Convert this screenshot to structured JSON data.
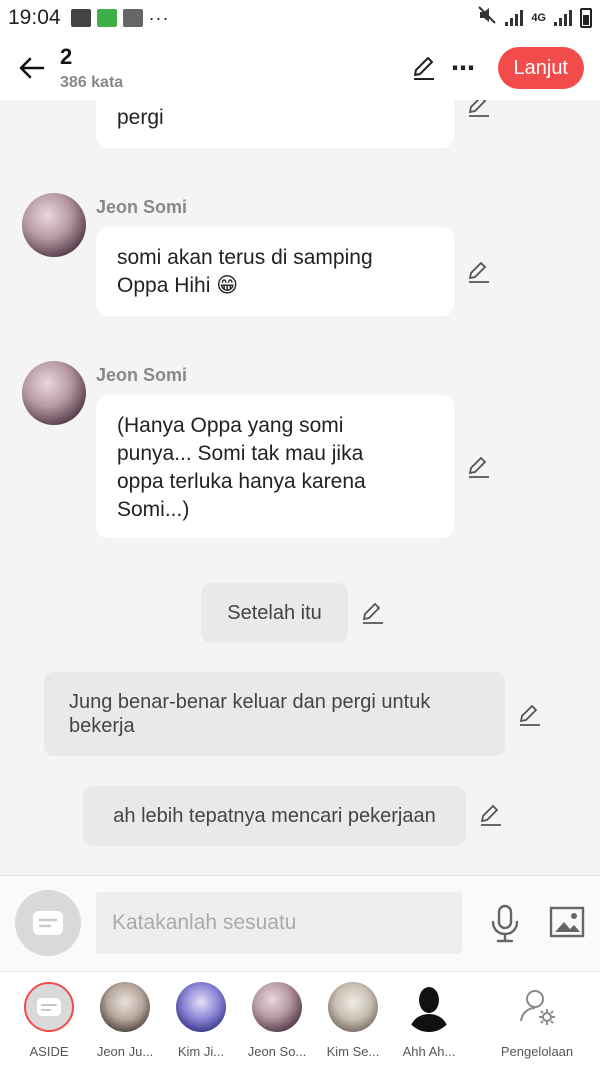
{
  "status_bar": {
    "time": "19:04",
    "network": "4G"
  },
  "header": {
    "title": "2",
    "word_count": "386 kata",
    "continue_label": "Lanjut"
  },
  "messages": [
    {
      "type": "dialog",
      "text": "pergi"
    },
    {
      "type": "dialog",
      "speaker": "Jeon Somi",
      "text_line1": "somi akan terus di samping",
      "text_line2": "Oppa Hihi 😁"
    },
    {
      "type": "dialog",
      "speaker": "Jeon Somi",
      "text_line1": "(Hanya Oppa yang somi",
      "text_line2": "punya... Somi tak mau jika",
      "text_line3": "oppa terluka hanya karena",
      "text_line4": "Somi...)"
    },
    {
      "type": "narration",
      "text": "Setelah itu"
    },
    {
      "type": "narration",
      "text_line1": "Jung benar-benar keluar dan pergi untuk",
      "text_line2": "bekerja"
    },
    {
      "type": "narration",
      "text": "ah lebih tepatnya mencari pekerjaan"
    }
  ],
  "input": {
    "placeholder": "Katakanlah sesuatu"
  },
  "characters": [
    {
      "label": "ASIDE"
    },
    {
      "label": "Jeon Ju..."
    },
    {
      "label": "Kim Ji..."
    },
    {
      "label": "Jeon So..."
    },
    {
      "label": "Kim Se..."
    },
    {
      "label": "Ahh Ah..."
    },
    {
      "label": "Pengelolaan"
    }
  ],
  "colors": {
    "accent": "#f24b4b",
    "background": "#f4f4f4",
    "bubble": "#ffffff",
    "narration": "#e9e9e9"
  },
  "icons": [
    "back-arrow-icon",
    "pencil-icon",
    "more-icon",
    "microphone-icon",
    "image-icon",
    "aside-icon",
    "manage-icon"
  ]
}
